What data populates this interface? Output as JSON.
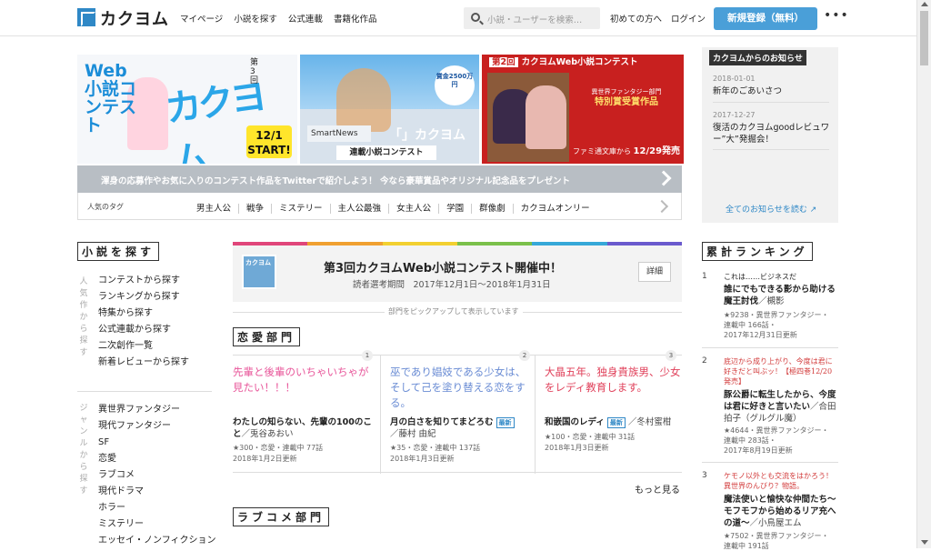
{
  "header": {
    "logo_mark": "「」",
    "logo_text": "カクヨム",
    "nav": [
      "マイページ",
      "小説を探す",
      "公式連載",
      "書籍化作品"
    ],
    "search_placeholder": "小説・ユーザーを検索…",
    "first_time": "初めての方へ",
    "login": "ログイン",
    "register": "新規登録（無料）",
    "more": "•••"
  },
  "banners": {
    "b1": {
      "title": "Web小説コンテスト",
      "logo": "カクヨム",
      "round": "第3回",
      "date": "12/1\nSTART!"
    },
    "b2": {
      "bubble": "賞金2500万円",
      "smartnews": "SmartNews",
      "kakuyomu": "「」カクヨム",
      "caption": "連載小説コンテスト"
    },
    "b3": {
      "badge": "第2回",
      "title": "カクヨムWeb小説コンテスト",
      "award_small": "異世界ファンタジー部門",
      "award_big": "特別賞受賞作品",
      "footer_label": "ファミ通文庫から",
      "footer_date": "12/29発売"
    }
  },
  "promo": "渾身の応募作やお気に入りのコンテスト作品をTwitterで紹介しよう！ 今なら豪華賞品やオリジナル記念品をプレゼント",
  "tags": {
    "label": "人気のタグ",
    "items": [
      "男主人公",
      "戦争",
      "ミステリー",
      "主人公最強",
      "女主人公",
      "学園",
      "群像劇",
      "カクヨムオンリー"
    ]
  },
  "notice": {
    "heading": "カクヨムからのお知らせ",
    "items": [
      {
        "date": "2018-01-01",
        "text": "新年のごあいさつ"
      },
      {
        "date": "2017-12-27",
        "text": "復活のカクヨムgoodレビュワー”大”発掘会！"
      }
    ],
    "all_link": "全てのお知らせを読む"
  },
  "left": {
    "search_heading": "小説を探す",
    "search_vert": "人気作から探す",
    "search_items": [
      "コンテストから探す",
      "ランキングから探す",
      "特集から探す",
      "公式連載から探す",
      "二次創作一覧",
      "新着レビューから探す"
    ],
    "genre_vert": "ジャンルから探す",
    "genre_items": [
      "異世界ファンタジー",
      "現代ファンタジー",
      "SF",
      "恋愛",
      "ラブコメ",
      "現代ドラマ",
      "ホラー",
      "ミステリー",
      "エッセイ・ノンフィクション"
    ]
  },
  "contest": {
    "colors": [
      "#e0467a",
      "#f0a030",
      "#f2d030",
      "#7ac04a",
      "#36a8d8",
      "#6a5acd"
    ],
    "thumb_text": "カクヨム",
    "title": "第3回カクヨムWeb小説コンテスト開催中！",
    "sub": "読者選考期間　2017年12月1日～2018年1月31日",
    "button": "詳細",
    "pick_note": "部門をピックアップして表示しています"
  },
  "romance": {
    "heading": "恋愛部門",
    "cards": [
      {
        "num": "1",
        "catch": "先輩と後輩のいちゃいちゃが見たい！！！",
        "color": "#e8569a",
        "title": "わたしの知らない、先輩の100のこと",
        "author": "／兎谷あおい",
        "new": "",
        "meta1": "★300・恋愛・連載中 77話",
        "meta2": "2018年1月2日更新"
      },
      {
        "num": "2",
        "catch": "巫であり娼妓である少女は、そして己を塗り替える恋をする。",
        "color": "#6a8cd4",
        "title": "月の白さを知りてまどろむ",
        "author": "／藤村 由紀",
        "new": "最新",
        "meta1": "★35・恋愛・連載中 137話",
        "meta2": "2018年1月3日更新"
      },
      {
        "num": "3",
        "catch": "大晶五年。独身貴族男、少女をレディ教育します。",
        "color": "#e0405a",
        "title": "和嵌国のレディ",
        "author": "／冬村蜜柑",
        "new": "最新",
        "meta1": "★100・恋愛・連載中 31話",
        "meta2": "2018年1月3日更新"
      }
    ],
    "more": "もっと見る"
  },
  "lovecome_heading": "ラブコメ部門",
  "ranking": {
    "heading": "累計ランキング",
    "items": [
      {
        "n": "1",
        "catch": "これは……ビジネスだ",
        "catch_color": "#222",
        "title": "誰にでもできる影から助ける魔王討伐",
        "author": "／槻影",
        "meta1": "★9238・異世界ファンタジー・",
        "meta2": "連載中 166話・",
        "meta3": "2017年12月31日更新"
      },
      {
        "n": "2",
        "catch": "底辺から成り上がり、今度は君に好きだと叫ぶッ！【極四巻12/20発売】",
        "catch_color": "#d23a3a",
        "title": "豚公爵に転生したから、今度は君に好きと言いたい",
        "author": "／合田拍子（グルグル魔）",
        "meta1": "★4644・異世界ファンタジー・",
        "meta2": "連載中 283話・",
        "meta3": "2017年8月19日更新"
      },
      {
        "n": "3",
        "catch": "ケモノ以外とも交流をはかろう！異世界のんびり？物語。",
        "catch_color": "#d23a3a",
        "title": "魔法使いと愉快な仲間たち～モフモフから始めるリア充への道～",
        "author": "／小鳥屋エム",
        "meta1": "★7502・異世界ファンタジー・",
        "meta2": "連載中 191話",
        "meta3": ""
      }
    ]
  }
}
